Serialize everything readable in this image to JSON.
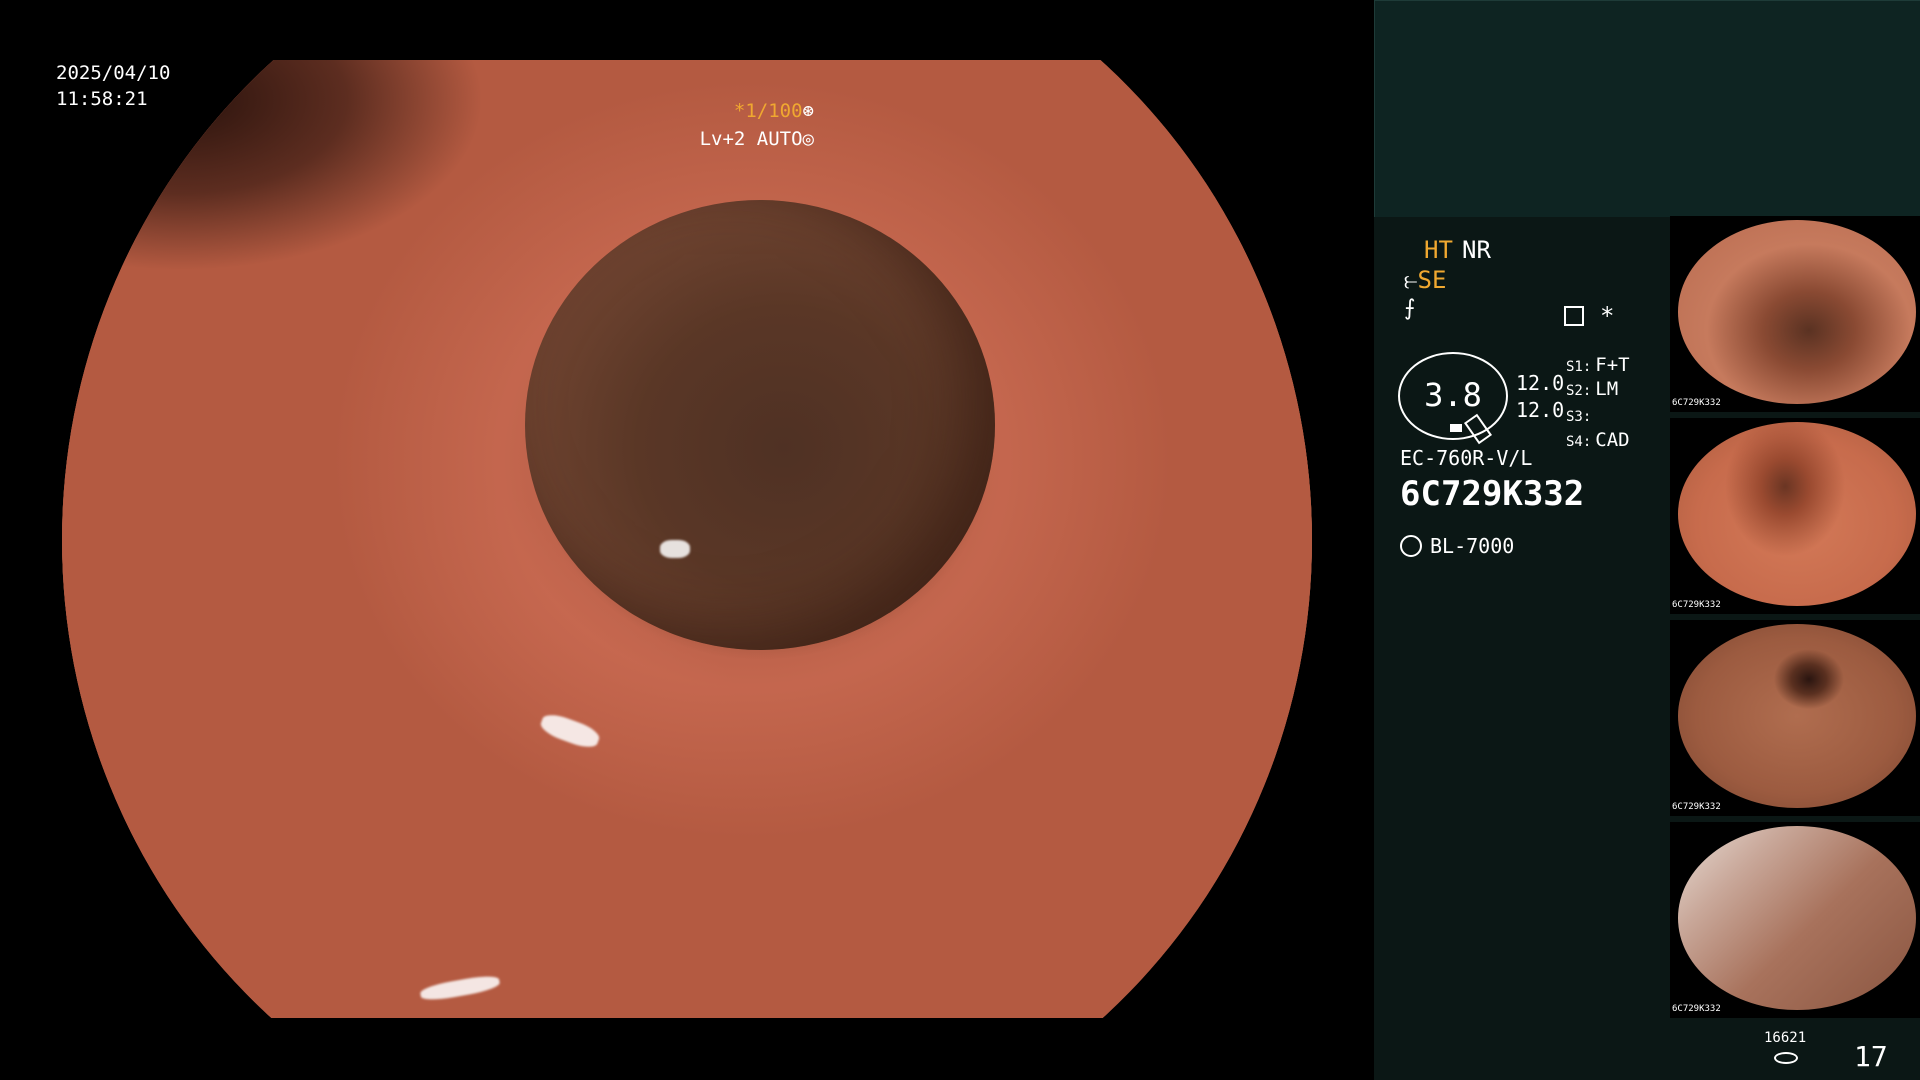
{
  "main_view": {
    "date": "2025/04/10",
    "time": "11:58:21",
    "shutter": "*1/100",
    "shutter_icon": "⊛",
    "iris": "Lv+2 AUTO",
    "iris_icon": "◎"
  },
  "info_panel": {
    "ht": "HT",
    "nr": "NR",
    "se_icon": "⥼",
    "se": "SE",
    "fnc_icon": "⨍",
    "star": "*",
    "zoom": "3.8",
    "values": [
      "12.0",
      "12.0"
    ],
    "switches": [
      {
        "key": "S1:",
        "value": "F+T"
      },
      {
        "key": "S2:",
        "value": "LM"
      },
      {
        "key": "S3:",
        "value": ""
      },
      {
        "key": "S4:",
        "value": "CAD"
      }
    ],
    "scope_model": "EC-760R-V/L",
    "scope_serial": "6C729K332",
    "light_source": "BL-7000"
  },
  "thumbnails": [
    {
      "serial": "6C729K332"
    },
    {
      "serial": "6C729K332"
    },
    {
      "serial": "6C729K332"
    },
    {
      "serial": "6C729K332"
    }
  ],
  "footer": {
    "count": "16621",
    "page": "17"
  }
}
